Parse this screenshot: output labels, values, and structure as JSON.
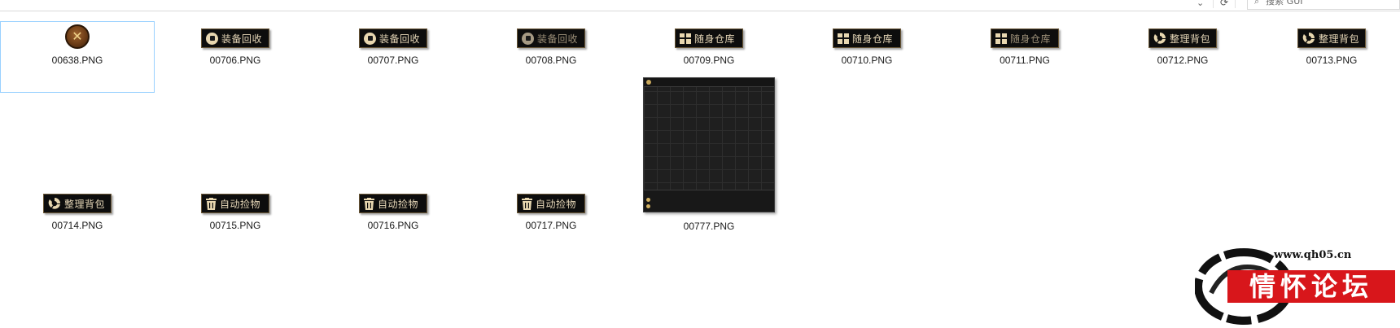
{
  "search": {
    "placeholder": "搜索 GUI"
  },
  "files": [
    {
      "name": "00638.PNG",
      "kind": "emblem"
    },
    {
      "name": "00706.PNG",
      "kind": "button",
      "label": "装备回收",
      "icon": "square-icon"
    },
    {
      "name": "00707.PNG",
      "kind": "button",
      "label": "装备回收",
      "icon": "square-icon"
    },
    {
      "name": "00708.PNG",
      "kind": "button",
      "label": "装备回收",
      "icon": "square-icon",
      "state": "dim"
    },
    {
      "name": "00709.PNG",
      "kind": "button",
      "label": "随身仓库",
      "icon": "gift-icon"
    },
    {
      "name": "00710.PNG",
      "kind": "button",
      "label": "随身仓库",
      "icon": "gift-icon"
    },
    {
      "name": "00711.PNG",
      "kind": "button",
      "label": "随身仓库",
      "icon": "gift-icon",
      "state": "dim"
    },
    {
      "name": "00712.PNG",
      "kind": "button",
      "label": "整理背包",
      "icon": "recycle-icon"
    },
    {
      "name": "00713.PNG",
      "kind": "button",
      "label": "整理背包",
      "icon": "recycle-icon"
    },
    {
      "name": "00714.PNG",
      "kind": "button",
      "label": "整理背包",
      "icon": "recycle-icon"
    },
    {
      "name": "00715.PNG",
      "kind": "button",
      "label": "自动捡物",
      "icon": "trash-icon"
    },
    {
      "name": "00716.PNG",
      "kind": "button",
      "label": "自动捡物",
      "icon": "trash-icon"
    },
    {
      "name": "00717.PNG",
      "kind": "button",
      "label": "自动捡物",
      "icon": "trash-icon"
    },
    {
      "name": "00777.PNG",
      "kind": "panel"
    }
  ],
  "watermark": {
    "url": "www.qh05.cn",
    "text": "情怀论坛"
  },
  "colors": {
    "selection_border": "#99d1ff",
    "button_bg": "#0d0d0d",
    "button_text": "#e6d7b8",
    "watermark_red": "#d8161b"
  }
}
